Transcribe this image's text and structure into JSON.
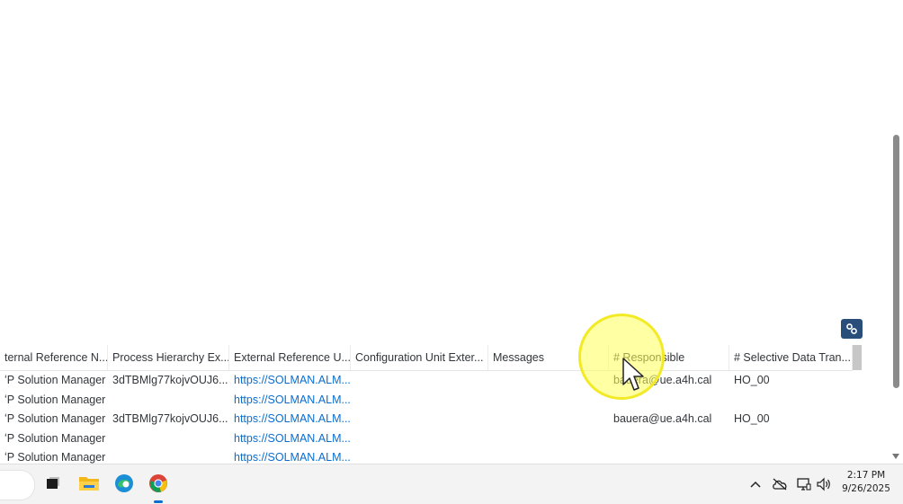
{
  "table": {
    "headers": [
      "ternal Reference N...",
      "Process Hierarchy Ex...",
      "External Reference U...",
      "Configuration Unit Exter...",
      "Messages",
      "# Responsible",
      "# Selective Data Tran..."
    ],
    "rows": [
      [
        "ʻP Solution Manager",
        "3dTBMlg77kojvOUJ6...",
        "https://SOLMAN.ALM...",
        "",
        "",
        "bauera@ue.a4h.cal",
        "HO_00"
      ],
      [
        "ʻP Solution Manager",
        "",
        "https://SOLMAN.ALM...",
        "",
        "",
        "",
        ""
      ],
      [
        "ʻP Solution Manager",
        "3dTBMlg77kojvOUJ6...",
        "https://SOLMAN.ALM...",
        "",
        "",
        "bauera@ue.a4h.cal",
        "HO_00"
      ],
      [
        "ʻP Solution Manager",
        "",
        "https://SOLMAN.ALM...",
        "",
        "",
        "",
        ""
      ],
      [
        "ʻP Solution Manager",
        "",
        "https://SOLMAN.ALM...",
        "",
        "",
        "",
        ""
      ]
    ]
  },
  "taskbar": {
    "apps": [
      "file-explorer-icon",
      "edge-icon",
      "chrome-icon"
    ],
    "time": "2:17 PM",
    "date": "9/26/2025"
  },
  "colors": {
    "link": "#0a6ed1",
    "settings_button": "#2a4e7a",
    "highlight": "#f2ea25"
  }
}
